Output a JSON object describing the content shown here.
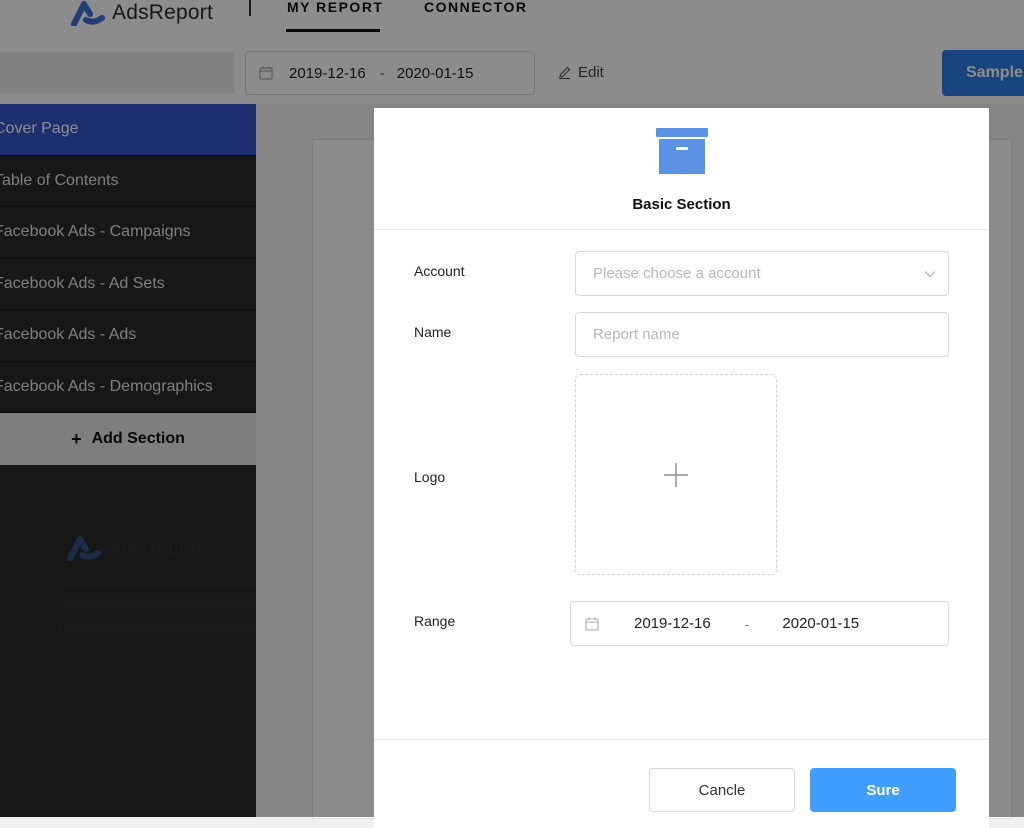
{
  "app": {
    "logo_text": "AdsReport",
    "nav": {
      "my_report": "MY REPORT",
      "connector": "CONNECTOR"
    }
  },
  "toolbar": {
    "start_date": "2019-12-16",
    "separator": "-",
    "end_date": "2020-01-15",
    "edit_label": "Edit",
    "sample_label": "Sample"
  },
  "sidebar": {
    "items": [
      {
        "label": "Cover Page"
      },
      {
        "label": "Table of Contents"
      },
      {
        "label": "Facebook Ads - Campaigns"
      },
      {
        "label": "Facebook Ads - Ad Sets"
      },
      {
        "label": "Facebook Ads - Ads"
      },
      {
        "label": "Facebook Ads - Demographics"
      }
    ],
    "add_label": "Add Section",
    "logo_text": "AdsReport"
  },
  "modal": {
    "title": "Basic Section",
    "account": {
      "label": "Account",
      "placeholder": "Please choose a account"
    },
    "name": {
      "label": "Name",
      "placeholder": "Report name"
    },
    "logo": {
      "label": "Logo"
    },
    "range": {
      "label": "Range",
      "start": "2019-12-16",
      "separator": "-",
      "end": "2020-01-15"
    },
    "cancel_label": "Cancle",
    "sure_label": "Sure"
  },
  "colors": {
    "accent": "#409eff",
    "sidebar_active": "#3557c8",
    "sidebar_bg": "#2a2a2a",
    "sample_button": "#2f7fe6",
    "icon_blue": "#5b92e5"
  }
}
